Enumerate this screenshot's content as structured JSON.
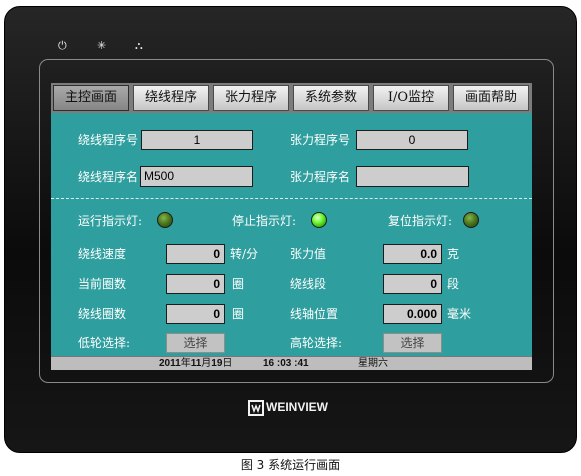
{
  "device": {
    "indicators": {
      "power": "⏻",
      "brightness": "✳",
      "network": "⛬"
    },
    "logo": "WEINVIEW"
  },
  "tabs": [
    "主控画面",
    "绕线程序",
    "张力程序",
    "系统参数",
    "I/O监控",
    "画面帮助"
  ],
  "active_tab": "主控画面",
  "program": {
    "winding_no_label": "绕线程序号",
    "winding_no_value": "1",
    "tension_no_label": "张力程序号",
    "tension_no_value": "0",
    "winding_name_label": "绕线程序名",
    "winding_name_value": "M500",
    "tension_name_label": "张力程序名",
    "tension_name_value": ""
  },
  "indicators": {
    "run_label": "运行指示灯:",
    "stop_label": "停止指示灯:",
    "reset_label": "复位指示灯:",
    "run_state": "off",
    "stop_state": "on",
    "reset_state": "off"
  },
  "values": {
    "winding_speed_label": "绕线速度",
    "winding_speed_value": "0",
    "winding_speed_unit": "转/分",
    "tension_label": "张力值",
    "tension_value": "0.0",
    "tension_unit": "克",
    "current_turns_label": "当前圈数",
    "current_turns_value": "0",
    "current_turns_unit": "圈",
    "winding_segment_label": "绕线段",
    "winding_segment_value": "0",
    "winding_segment_unit": "段",
    "winding_turns_label": "绕线圈数",
    "winding_turns_value": "0",
    "winding_turns_unit": "圈",
    "spindle_pos_label": "线轴位置",
    "spindle_pos_value": "0.000",
    "spindle_pos_unit": "毫米"
  },
  "selects": {
    "low_wheel_label": "低轮选择:",
    "low_wheel_button": "选择",
    "high_wheel_label": "高轮选择:",
    "high_wheel_button": "选择"
  },
  "status": {
    "year": "2011",
    "year_char": "年",
    "month": "11",
    "month_char": "月",
    "day": "19",
    "day_char": "日",
    "time": "16 :03 :41",
    "weekday": "星期六"
  },
  "caption": "图 3  系统运行画面",
  "colors": {
    "panel": "#2f9e9e",
    "bezel": "#111111",
    "lamp_on": "#79ff3d",
    "lamp_off": "#4c7a20"
  }
}
